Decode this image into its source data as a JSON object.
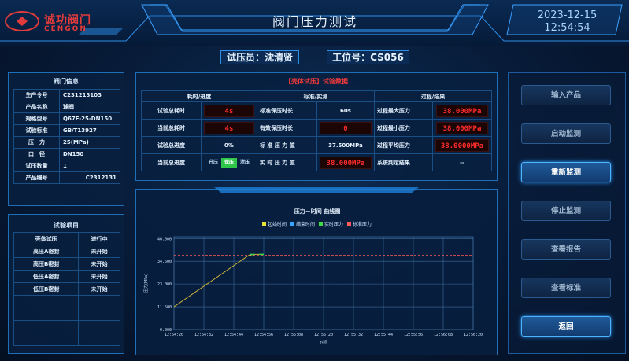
{
  "header": {
    "logo_cn": "诚功阀门",
    "logo_en": "CENGON",
    "title": "阀门压力测试",
    "date": "2023-12-15",
    "time": "12:54:54"
  },
  "operator": {
    "label": "试压员",
    "name": "沈清贤",
    "text": "试压员：沈清贤"
  },
  "station": {
    "label": "工位号",
    "value": "CS056",
    "text": "工位号：CS056"
  },
  "valve_info": {
    "title": "阀门信息",
    "rows": [
      {
        "k": "生产令号",
        "v": "C231213103"
      },
      {
        "k": "产品名称",
        "v": "球阀"
      },
      {
        "k": "规格型号",
        "v": "Q67F-25-DN150"
      },
      {
        "k": "试验标准",
        "v": "GB/T13927"
      },
      {
        "k": "压　力",
        "v": "25(MPa)"
      },
      {
        "k": "口　径",
        "v": "DN150"
      },
      {
        "k": "试压数量",
        "v": "1"
      },
      {
        "k": "产品编号",
        "v": "C2312131"
      }
    ]
  },
  "test_items": {
    "title": "试验项目",
    "rows": [
      {
        "k": "壳体试压",
        "v": "进行中",
        "state": "run"
      },
      {
        "k": "高压A密封",
        "v": "未开始",
        "state": "idle"
      },
      {
        "k": "高压B密封",
        "v": "未开始",
        "state": "idle"
      },
      {
        "k": "低压A密封",
        "v": "未开始",
        "state": "idle"
      },
      {
        "k": "低压B密封",
        "v": "未开始",
        "state": "idle"
      }
    ]
  },
  "test_data": {
    "title": "【壳体试压】试验数据",
    "heads": [
      "耗时/进度",
      "标准/实测",
      "过程/结果"
    ],
    "total_time_label": "试验总耗时",
    "total_time": "4s",
    "cur_time_label": "当前总耗时",
    "cur_time": "4s",
    "total_prog_label": "试验总进度",
    "total_prog": "0%",
    "cur_prog_label": "当前总进度",
    "stages": [
      "升压",
      "保压",
      "泄压"
    ],
    "std_hold_label": "标准保压时长",
    "std_hold": "60s",
    "eff_hold_label": "有效保压时长",
    "eff_hold": "0",
    "std_p_label": "标 准 压 力 值",
    "std_p": "37.500MPa",
    "real_p_label": "实 时 压 力 值",
    "real_p": "38.000MPa",
    "max_p_label": "过程最大压力",
    "max_p": "38.000MPa",
    "min_p_label": "过程最小压力",
    "min_p": "38.000MPa",
    "avg_p_label": "过程平均压力",
    "avg_p": "38.0000MPa",
    "result_label": "系统判定结果",
    "result": "--"
  },
  "buttons": [
    {
      "label": "输入产品",
      "active": false
    },
    {
      "label": "启动监测",
      "active": false
    },
    {
      "label": "重新监测",
      "active": true
    },
    {
      "label": "停止监测",
      "active": false
    },
    {
      "label": "查看报告",
      "active": false
    },
    {
      "label": "查看标准",
      "active": false
    },
    {
      "label": "返回",
      "active": true
    }
  ],
  "colors": {
    "accent": "#2f9cff",
    "red": "#ff2c2c",
    "running": "#ffcf2e",
    "stage_on": "#2ec74a"
  },
  "chart_data": {
    "type": "line",
    "title": "压力－时间 曲线图",
    "ylabel": "压力(MPa)",
    "xlabel": "时间",
    "legend": [
      {
        "name": "起始时间",
        "color": "#e6e23a"
      },
      {
        "name": "结束时间",
        "color": "#3aa6ff"
      },
      {
        "name": "实时压力",
        "color": "#3fd84a"
      },
      {
        "name": "标准压力",
        "color": "#ff5a5a"
      }
    ],
    "ylim": [
      0,
      46.9
    ],
    "yticks": [
      "0.000",
      "11.500",
      "23.000",
      "34.500",
      "46.000"
    ],
    "yvals": [
      0,
      11.5,
      23,
      34.5,
      46
    ],
    "xticks": [
      "12:54:20",
      "12:54:32",
      "12:54:44",
      "12:54:56",
      "12:55:08",
      "12:55:20",
      "12:55:32",
      "12:55:44",
      "12:55:56",
      "12:56:08",
      "12:56:20"
    ],
    "standard": 37.5,
    "series": [
      {
        "name": "实时压力",
        "points": [
          [
            0,
            11.5
          ],
          [
            0.25,
            37.5
          ],
          [
            0.27,
            38
          ],
          [
            0.3,
            38
          ]
        ]
      }
    ]
  }
}
